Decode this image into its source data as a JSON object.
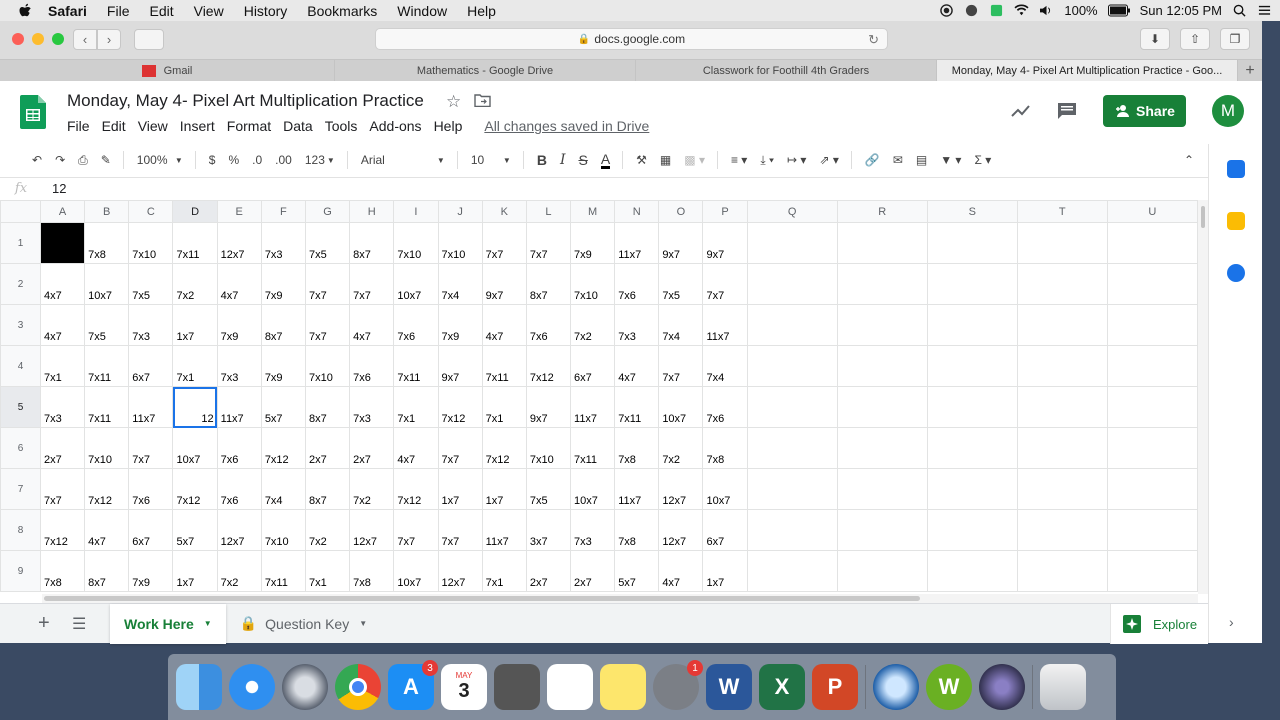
{
  "mac_menu": {
    "app": "Safari",
    "items": [
      "File",
      "Edit",
      "View",
      "History",
      "Bookmarks",
      "Window",
      "Help"
    ],
    "battery": "100%",
    "clock": "Sun 12:05 PM"
  },
  "browser": {
    "url": "docs.google.com",
    "tabs": [
      {
        "label": "Gmail"
      },
      {
        "label": "Mathematics - Google Drive"
      },
      {
        "label": "Classwork for Foothill 4th Graders"
      },
      {
        "label": "Monday, May 4- Pixel Art Multiplication Practice - Goo..."
      }
    ]
  },
  "doc": {
    "title": "Monday, May 4- Pixel Art Multiplication Practice",
    "menus": [
      "File",
      "Edit",
      "View",
      "Insert",
      "Format",
      "Data",
      "Tools",
      "Add-ons",
      "Help"
    ],
    "saved_status": "All changes saved in Drive",
    "share_label": "Share",
    "avatar_letter": "M"
  },
  "toolbar": {
    "zoom": "100%",
    "currency": "$",
    "percent": "%",
    "dec_less": ".0",
    "dec_more": ".00",
    "more_formats": "123",
    "font": "Arial",
    "font_size": "10",
    "bold": "B",
    "italic": "I",
    "strike": "S",
    "text_color": "A"
  },
  "formula_bar": {
    "fx": "fx",
    "value": "12"
  },
  "columns": [
    "A",
    "B",
    "C",
    "D",
    "E",
    "F",
    "G",
    "H",
    "I",
    "J",
    "K",
    "L",
    "M",
    "N",
    "O",
    "P",
    "Q",
    "R",
    "S",
    "T",
    "U"
  ],
  "rows": [
    {
      "num": "1",
      "cells": [
        "",
        "7x8",
        "7x10",
        "7x11",
        "12x7",
        "7x3",
        "7x5",
        "8x7",
        "7x10",
        "7x10",
        "7x7",
        "7x7",
        "7x9",
        "11x7",
        "9x7",
        "9x7"
      ]
    },
    {
      "num": "2",
      "cells": [
        "4x7",
        "10x7",
        "7x5",
        "7x2",
        "4x7",
        "7x9",
        "7x7",
        "7x7",
        "10x7",
        "7x4",
        "9x7",
        "8x7",
        "7x10",
        "7x6",
        "7x5",
        "7x7"
      ]
    },
    {
      "num": "3",
      "cells": [
        "4x7",
        "7x5",
        "7x3",
        "1x7",
        "7x9",
        "8x7",
        "7x7",
        "4x7",
        "7x6",
        "7x9",
        "4x7",
        "7x6",
        "7x2",
        "7x3",
        "7x4",
        "11x7"
      ]
    },
    {
      "num": "4",
      "cells": [
        "7x1",
        "7x11",
        "6x7",
        "7x1",
        "7x3",
        "7x9",
        "7x10",
        "7x6",
        "7x11",
        "9x7",
        "7x11",
        "7x12",
        "6x7",
        "4x7",
        "7x7",
        "7x4"
      ]
    },
    {
      "num": "5",
      "cells": [
        "7x3",
        "7x11",
        "11x7",
        "12",
        "11x7",
        "5x7",
        "8x7",
        "7x3",
        "7x1",
        "7x12",
        "7x1",
        "9x7",
        "11x7",
        "7x11",
        "10x7",
        "7x6"
      ]
    },
    {
      "num": "6",
      "cells": [
        "2x7",
        "7x10",
        "7x7",
        "10x7",
        "7x6",
        "7x12",
        "2x7",
        "2x7",
        "4x7",
        "7x7",
        "7x12",
        "7x10",
        "7x11",
        "7x8",
        "7x2",
        "7x8"
      ]
    },
    {
      "num": "7",
      "cells": [
        "7x7",
        "7x12",
        "7x6",
        "7x12",
        "7x6",
        "7x4",
        "8x7",
        "7x2",
        "7x12",
        "1x7",
        "1x7",
        "7x5",
        "10x7",
        "11x7",
        "12x7",
        "10x7"
      ]
    },
    {
      "num": "8",
      "cells": [
        "7x12",
        "4x7",
        "6x7",
        "5x7",
        "12x7",
        "7x10",
        "7x2",
        "12x7",
        "7x7",
        "7x7",
        "11x7",
        "3x7",
        "7x3",
        "7x8",
        "12x7",
        "6x7"
      ]
    },
    {
      "num": "9",
      "cells": [
        "7x8",
        "8x7",
        "7x9",
        "1x7",
        "7x2",
        "7x11",
        "7x1",
        "7x8",
        "10x7",
        "12x7",
        "7x1",
        "2x7",
        "2x7",
        "5x7",
        "4x7",
        "1x7"
      ]
    }
  ],
  "sheet_tabs": [
    {
      "label": "Work Here"
    },
    {
      "label": "Question Key"
    }
  ],
  "explore_label": "Explore",
  "dock": {
    "calendar_month": "MAY",
    "calendar_day": "3",
    "appstore_badge": "3",
    "prefs_badge": "1"
  },
  "colors": {
    "sheets_green": "#188038",
    "selection_blue": "#1a73e8"
  }
}
